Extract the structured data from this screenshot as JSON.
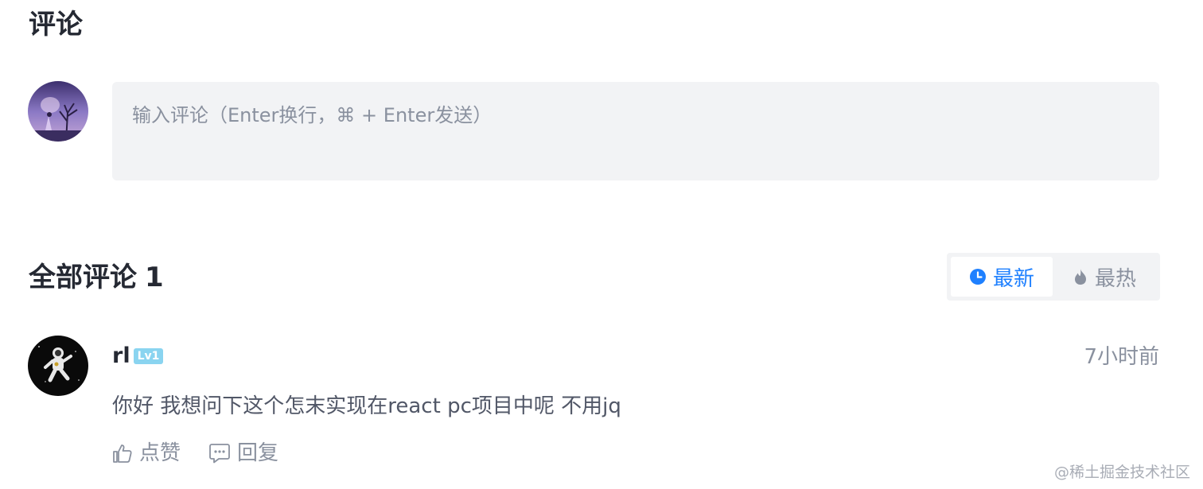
{
  "comments": {
    "title": "评论",
    "input_placeholder": "输入评论（Enter换行，⌘ + Enter发送）"
  },
  "all_comments": {
    "title": "全部评论",
    "count": "1",
    "sort": {
      "latest_label": "最新",
      "hot_label": "最热",
      "active": "latest",
      "active_color": "#1e80ff"
    }
  },
  "comment_item": {
    "username": "rl",
    "level": "Lv1",
    "time": "7小时前",
    "content": "你好 我想问下这个怎末实现在react pc项目中呢 不用jq",
    "like_label": "点赞",
    "reply_label": "回复"
  },
  "watermark": "@稀土掘金技术社区",
  "icons": {
    "latest": "clock-icon",
    "hot": "flame-icon",
    "like": "thumbs-up-icon",
    "reply": "comment-bubble-icon"
  }
}
